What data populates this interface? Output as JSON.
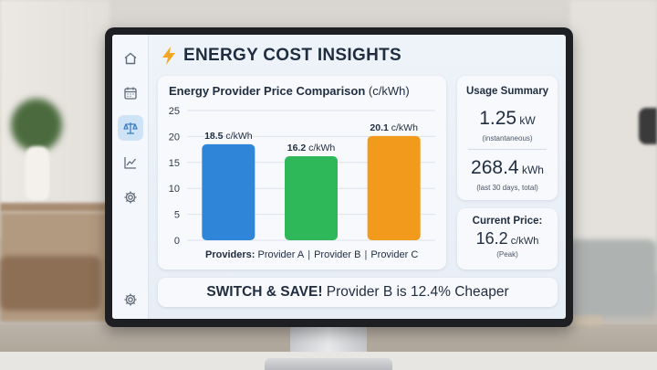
{
  "app": {
    "title": "ENERGY COST INSIGHTS"
  },
  "sidebar": {
    "items": [
      {
        "name": "home",
        "icon": "home-icon",
        "active": false
      },
      {
        "name": "calendar",
        "icon": "calendar-icon",
        "active": false
      },
      {
        "name": "compare",
        "icon": "scale-icon",
        "active": true
      },
      {
        "name": "trends",
        "icon": "line-chart-icon",
        "active": false
      },
      {
        "name": "settings",
        "icon": "gear-icon",
        "active": false
      }
    ],
    "bottom_icon": "gear-icon"
  },
  "chart_card": {
    "title_bold": "Energy Provider Price Comparison",
    "title_unit": " (c/kWh)",
    "providers_label": "Providers:",
    "provider_names": [
      "Provider A",
      "Provider B",
      "Provider C"
    ],
    "separator": "|"
  },
  "chart_data": {
    "type": "bar",
    "title": "Energy Provider Price Comparison (c/kWh)",
    "xlabel": "Providers:",
    "ylabel": "",
    "categories": [
      "Provider A",
      "Provider B",
      "Provider C"
    ],
    "values": [
      18.5,
      16.2,
      20.1
    ],
    "data_labels": [
      "18.5 c/kWh",
      "16.2 c/kWh",
      "20.1 c/kWh"
    ],
    "colors": [
      "#2f86d9",
      "#2fb85a",
      "#f29a1c"
    ],
    "ylim": [
      0,
      25
    ],
    "yticks": [
      0,
      5,
      10,
      15,
      20,
      25
    ],
    "grid": true
  },
  "usage": {
    "heading": "Usage Summary",
    "instant_value": "1.25",
    "instant_unit": " kW",
    "instant_note": "(instantaneous)",
    "total_value": "268.4",
    "total_unit": " kWh",
    "total_note": "(last 30 days, total)"
  },
  "price": {
    "heading": "Current Price:",
    "value": "16.2",
    "unit": " c/kWh",
    "note": "(Peak)"
  },
  "banner": {
    "bold": "SWITCH & SAVE!",
    "text": " Provider B is 12.4% Cheaper"
  },
  "colors": {
    "accent": "#f5a623",
    "active_nav": "#cfe3f7",
    "text": "#1f2d40"
  }
}
